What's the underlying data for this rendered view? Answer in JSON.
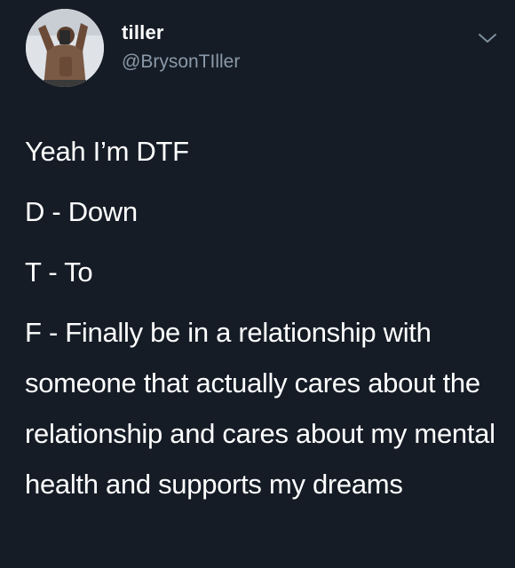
{
  "user": {
    "display_name": "tiller",
    "handle": "@BrysonTIller",
    "avatar_icon": "profile-photo",
    "menu_icon": "chevron-down-icon"
  },
  "tweet": {
    "lines": [
      "Yeah I’m DTF",
      "D - Down",
      "T - To",
      "F - Finally be in a relationship with someone that actually cares about the relationship and cares about my mental health and supports my dreams"
    ]
  },
  "colors": {
    "background": "#151c26",
    "text": "#ffffff",
    "handle": "#8a99a8",
    "caret": "#7f8e9d"
  }
}
